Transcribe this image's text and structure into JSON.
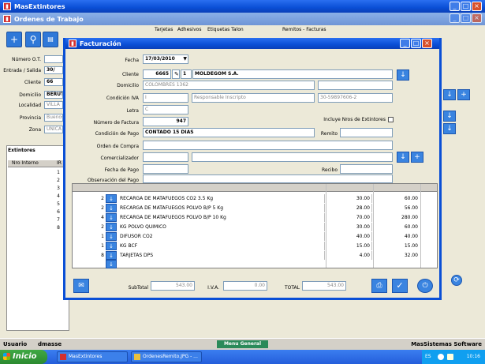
{
  "app": {
    "title": "MasExtintores"
  },
  "ot_window": {
    "title": "Ordenes de Trabajo",
    "tab_labels": [
      "Tarjetas",
      "Adhesivos",
      "Etiquetas Talon",
      "Remitos - Facturas"
    ],
    "labels": {
      "numero": "Número O.T.",
      "entrada": "Entrada / Salida",
      "cliente": "Cliente",
      "domicilio": "Domicilio",
      "localidad": "Localidad",
      "provincia": "Provincia",
      "zona": "Zona"
    },
    "values": {
      "entrada": "30/",
      "cliente": "66",
      "domicilio": "BERUT",
      "localidad": "VILLA",
      "provincia": "Buenos",
      "zona": "UNICA"
    },
    "extintores_tab": "Extintores",
    "extintores_header": "Nro Interno",
    "extintores_header2": "IR",
    "extintores_rows": [
      "1",
      "2",
      "3",
      "4",
      "5",
      "6",
      "7",
      "8"
    ]
  },
  "factura": {
    "title": "Facturación",
    "labels": {
      "fecha": "Fecha",
      "cliente": "Cliente",
      "domicilio": "Domicilio",
      "condicion_iva": "Condición IVA",
      "letra": "Letra",
      "numero_factura": "Número de Factura",
      "condicion_pago": "Condición de Pago",
      "orden_compra": "Orden de Compra",
      "comercializador": "Comercializador",
      "fecha_pago": "Fecha de Pago",
      "observacion": "Observación del Pago",
      "incluye": "Incluye Nros de Extintores",
      "remito": "Remito",
      "recibo": "Recibo",
      "subtotal": "SubTotal",
      "iva": "I.V.A.",
      "total": "TOTAL"
    },
    "values": {
      "fecha": "17/03/2010",
      "cliente_code": "6665",
      "cliente_suc": "1",
      "cliente_nombre": "MOLDEGOM S.A.",
      "domicilio": "COLOMBRES 1362",
      "iva_code": "I",
      "iva_desc": "Responsable Inscripto",
      "cuit": "30-59897606-2",
      "letra": "C",
      "numero_factura": "947",
      "condicion_pago": "CONTADO 15 DIAS",
      "subtotal": "543.00",
      "iva": "0.00",
      "total": "543.00"
    },
    "items": [
      {
        "cant": "2",
        "desc": "RECARGA DE MATAFUEGOS CO2 3.5 Kg",
        "pu": "30.00",
        "tot": "60.00"
      },
      {
        "cant": "2",
        "desc": "RECARGA DE MATAFUEGOS POLVO B/P 5 Kg",
        "pu": "28.00",
        "tot": "56.00"
      },
      {
        "cant": "4",
        "desc": "RECARGA DE MATAFUEGOS POLVO B/P 10 Kg",
        "pu": "70.00",
        "tot": "280.00"
      },
      {
        "cant": "2",
        "desc": "KG POLVO QUIMICO",
        "pu": "30.00",
        "tot": "60.00"
      },
      {
        "cant": "1",
        "desc": "DIFUSOR CO2",
        "pu": "40.00",
        "tot": "40.00"
      },
      {
        "cant": "1",
        "desc": "KG BCF",
        "pu": "15.00",
        "tot": "15.00"
      },
      {
        "cant": "8",
        "desc": "TARJETAS DPS",
        "pu": "4.00",
        "tot": "32.00"
      }
    ]
  },
  "status": {
    "usuario_label": "Usuario",
    "usuario": "dmasse",
    "menu": "Menu General",
    "company": "MasSistemas Software"
  },
  "taskbar": {
    "start": "Inicio",
    "task1": "MasExtintores",
    "task2": "OrdenesRemito.JPG - ...",
    "lang": "ES",
    "clock": "10:16"
  }
}
